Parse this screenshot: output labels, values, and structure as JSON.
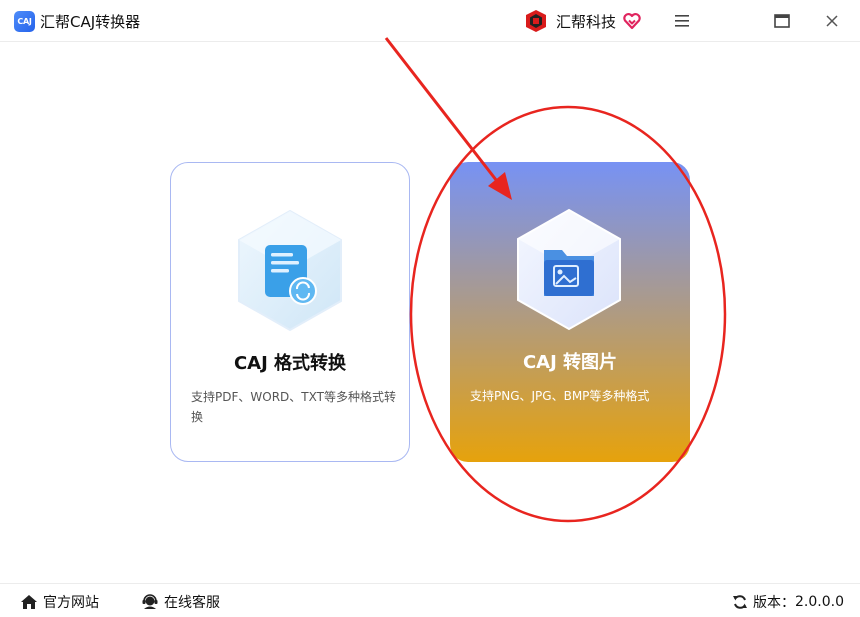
{
  "window": {
    "app_logo_text": "CAJ",
    "title": "汇帮CAJ转换器",
    "brand_name": "汇帮科技",
    "controls": {
      "menu_icon": "hamburger-icon",
      "maximize_icon": "maximize-icon",
      "close_icon": "close-icon"
    }
  },
  "cards": [
    {
      "id": "caj-format-convert",
      "title": "CAJ 格式转换",
      "description": "支持PDF、WORD、TXT等多种格式转换",
      "icon": "document-convert-icon",
      "style": "outline"
    },
    {
      "id": "caj-to-image",
      "title": "CAJ 转图片",
      "description": "支持PNG、JPG、BMP等多种格式",
      "icon": "image-folder-icon",
      "style": "gradient-selected"
    }
  ],
  "annotation": {
    "type": "red arrow and ellipse highlighting the CAJ 转图片 card",
    "color": "#e8251f"
  },
  "footer": {
    "official_site": "官方网站",
    "online_service": "在线客服",
    "version_label": "版本：",
    "version_value": "2.0.0.0"
  },
  "colors": {
    "accent_blue": "#7792f4",
    "accent_orange": "#e6a20c",
    "card_border": "#a9b8f2",
    "annotation_red": "#e8251f"
  }
}
